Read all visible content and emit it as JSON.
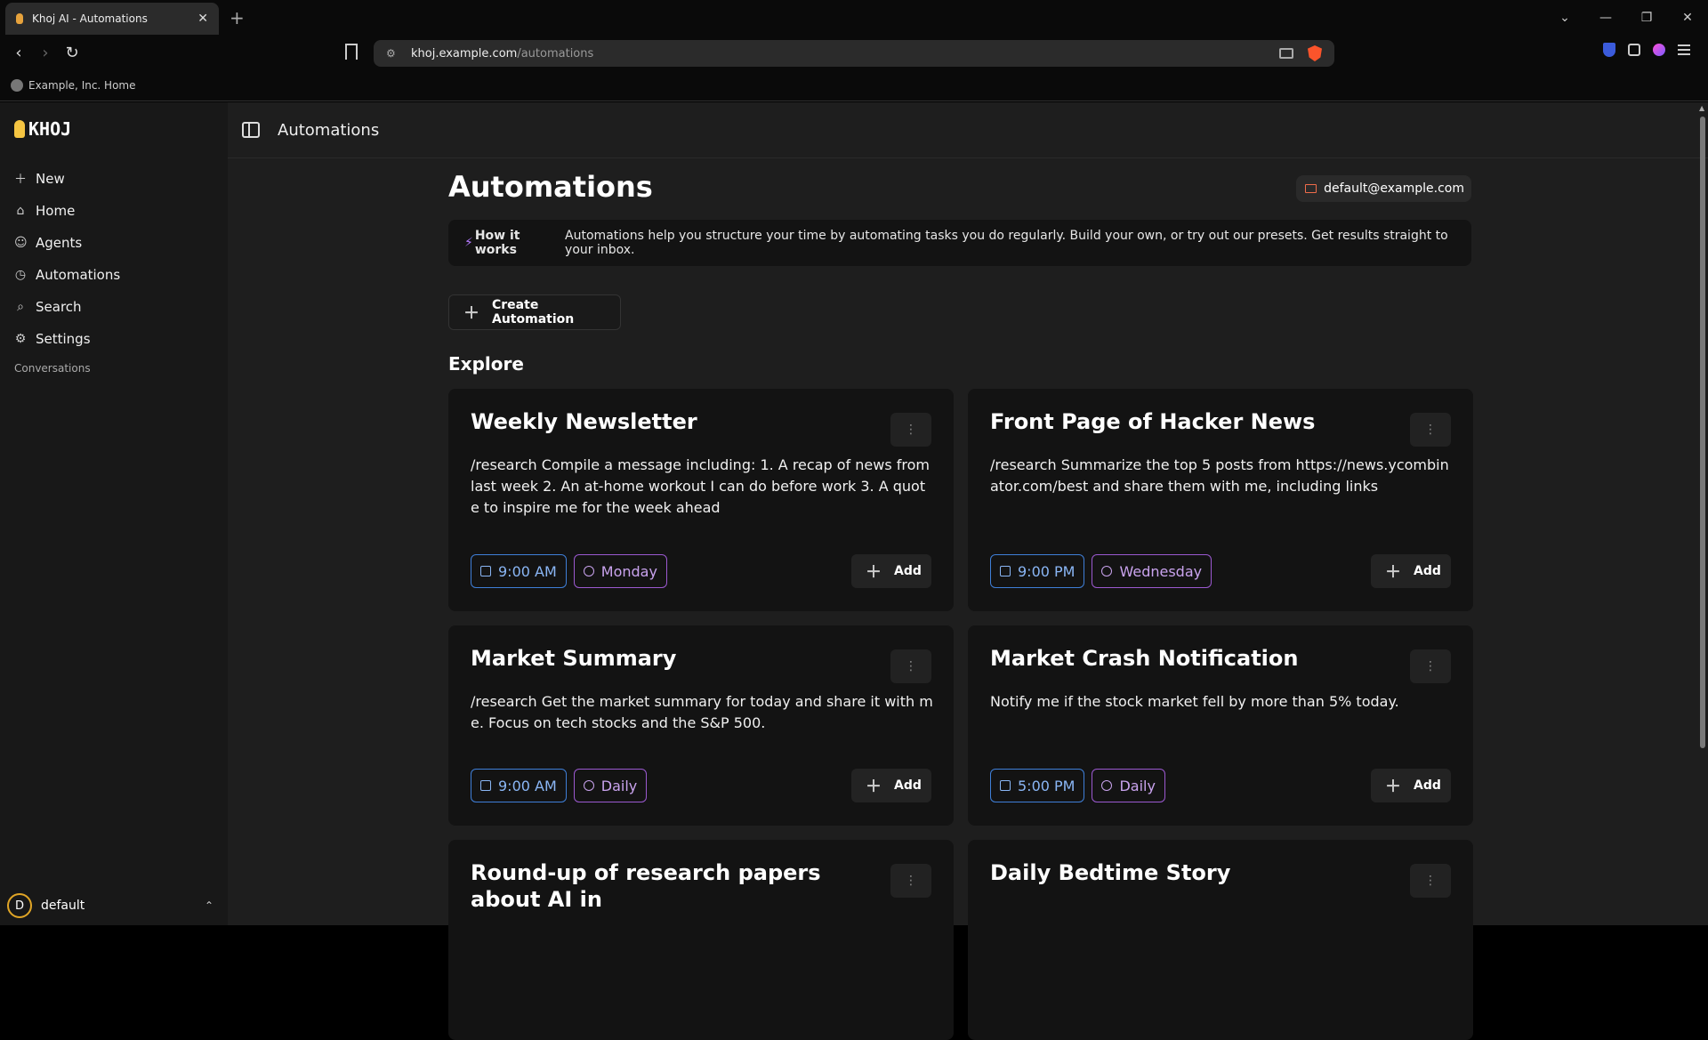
{
  "browser": {
    "tab_title": "Khoj AI - Automations",
    "url_host": "khoj.example.com",
    "url_path": "/automations",
    "bookmark": "Example, Inc. Home"
  },
  "sidebar": {
    "logo": "KHOJ",
    "items": [
      {
        "label": "New",
        "icon": "plus-icon"
      },
      {
        "label": "Home",
        "icon": "home-icon"
      },
      {
        "label": "Agents",
        "icon": "agents-icon"
      },
      {
        "label": "Automations",
        "icon": "automations-icon"
      },
      {
        "label": "Search",
        "icon": "search-icon"
      },
      {
        "label": "Settings",
        "icon": "gear-icon"
      }
    ],
    "conversations_label": "Conversations",
    "user": {
      "initial": "D",
      "name": "default"
    }
  },
  "header": {
    "title": "Automations"
  },
  "page": {
    "title": "Automations",
    "email": "default@example.com",
    "how_it_works_bold": "How it works",
    "how_it_works_text": "Automations help you structure your time by automating tasks you do regularly. Build your own, or try out our presets. Get results straight to your inbox.",
    "create_label": "Create Automation",
    "explore_label": "Explore"
  },
  "cards": [
    {
      "title": "Weekly Newsletter",
      "desc": "/research Compile a message including: 1. A recap of news from last week 2. An at-home workout I can do before work 3. A quote to inspire me for the week ahead",
      "time": "9:00 AM",
      "day": "Monday",
      "add": "Add"
    },
    {
      "title": "Front Page of Hacker News",
      "desc": "/research Summarize the top 5 posts from https://news.ycombinator.com/best and share them with me, including links",
      "time": "9:00 PM",
      "day": "Wednesday",
      "add": "Add"
    },
    {
      "title": "Market Summary",
      "desc": "/research Get the market summary for today and share it with me. Focus on tech stocks and the S&P 500.",
      "time": "9:00 AM",
      "day": "Daily",
      "add": "Add"
    },
    {
      "title": "Market Crash Notification",
      "desc": "Notify me if the stock market fell by more than 5% today.",
      "time": "5:00 PM",
      "day": "Daily",
      "add": "Add"
    },
    {
      "title": "Round-up of research papers about AI in",
      "desc": "",
      "time": "",
      "day": "",
      "add": ""
    },
    {
      "title": "Daily Bedtime Story",
      "desc": "",
      "time": "",
      "day": "",
      "add": ""
    }
  ]
}
